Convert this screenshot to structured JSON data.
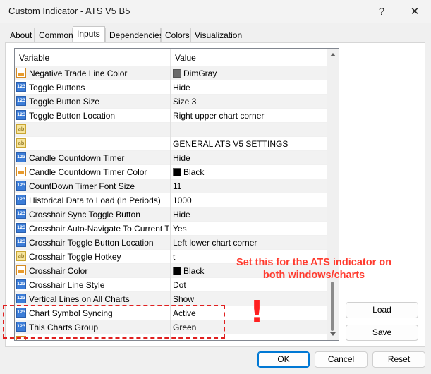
{
  "window": {
    "title": "Custom Indicator - ATS V5 B5",
    "help_glyph": "?",
    "close_glyph": "✕"
  },
  "tabs": [
    {
      "label": "About"
    },
    {
      "label": "Common"
    },
    {
      "label": "Inputs"
    },
    {
      "label": "Dependencies"
    },
    {
      "label": "Colors"
    },
    {
      "label": "Visualization"
    }
  ],
  "grid": {
    "header_variable": "Variable",
    "header_value": "Value",
    "rows": [
      {
        "icon": "color-icon",
        "name": "Negative Trade Line Color",
        "value": "DimGray",
        "swatch": "#6b6b6b"
      },
      {
        "icon": "numeric-icon",
        "name": "Toggle Buttons",
        "value": "Hide"
      },
      {
        "icon": "numeric-icon",
        "name": "Toggle Button Size",
        "value": "Size 3"
      },
      {
        "icon": "numeric-icon",
        "name": "Toggle Button Location",
        "value": "Right upper chart corner"
      },
      {
        "icon": "string-icon",
        "name": "",
        "value": ""
      },
      {
        "icon": "string-icon",
        "name": "",
        "value": "GENERAL ATS V5 SETTINGS"
      },
      {
        "icon": "numeric-icon",
        "name": "Candle Countdown Timer",
        "value": "Hide"
      },
      {
        "icon": "color-icon",
        "name": "Candle Countdown Timer Color",
        "value": "Black",
        "swatch": "#000000"
      },
      {
        "icon": "numeric-icon",
        "name": "CountDown Timer Font Size",
        "value": "11"
      },
      {
        "icon": "numeric-icon",
        "name": "Historical Data to Load (In Periods)",
        "value": "1000"
      },
      {
        "icon": "numeric-icon",
        "name": "Crosshair Sync Toggle Button",
        "value": "Hide"
      },
      {
        "icon": "numeric-icon",
        "name": "Crosshair Auto-Navigate To Current Tim...",
        "value": "Yes"
      },
      {
        "icon": "numeric-icon",
        "name": "Crosshair Toggle Button Location",
        "value": "Left lower chart corner"
      },
      {
        "icon": "string-icon",
        "name": "Crosshair Toggle Hotkey",
        "value": "t"
      },
      {
        "icon": "color-icon",
        "name": "Crosshair Color",
        "value": "Black",
        "swatch": "#000000"
      },
      {
        "icon": "numeric-icon",
        "name": "Crosshair Line Style",
        "value": "Dot"
      },
      {
        "icon": "numeric-icon",
        "name": "Vertical Lines on All Charts",
        "value": "Show"
      },
      {
        "icon": "numeric-icon",
        "name": "Chart Symbol Syncing",
        "value": "Active"
      },
      {
        "icon": "numeric-icon",
        "name": "This Charts Group",
        "value": "Green"
      },
      {
        "icon": "color-icon",
        "name": "",
        "value": ""
      }
    ]
  },
  "buttons": {
    "load": "Load",
    "save": "Save",
    "ok": "OK",
    "cancel": "Cancel",
    "reset": "Reset"
  },
  "annotation": {
    "callout_line1": "Set this for the ATS indicator on",
    "callout_line2": "both windows/charts",
    "exclamation": "!"
  },
  "colors": {
    "accent": "#0078d4",
    "annotation_red": "#ff3b2f"
  }
}
